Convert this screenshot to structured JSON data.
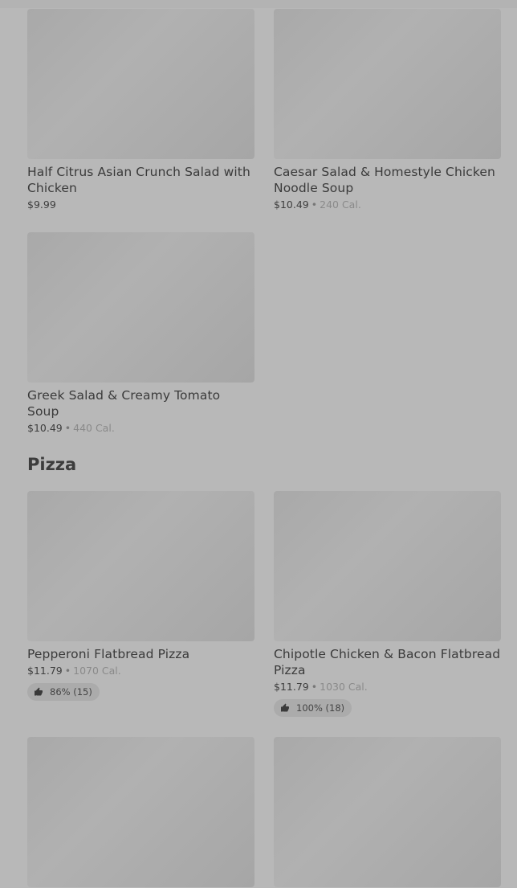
{
  "salads_and_soups": {
    "items": [
      {
        "name": "Half Citrus Asian Crunch Salad with Chicken",
        "price": "$9.99",
        "calories": ""
      },
      {
        "name": "Caesar Salad & Homestyle Chicken Noodle Soup",
        "price": "$10.49",
        "calories": "240 Cal."
      },
      {
        "name": "Greek Salad & Creamy Tomato Soup",
        "price": "$10.49",
        "calories": "440 Cal."
      }
    ]
  },
  "pizza": {
    "title": "Pizza",
    "items": [
      {
        "name": "Pepperoni Flatbread Pizza",
        "price": "$11.79",
        "calories": "1070 Cal.",
        "rating": "86% (15)"
      },
      {
        "name": "Chipotle Chicken & Bacon Flatbread Pizza",
        "price": "$11.79",
        "calories": "1030 Cal.",
        "rating": "100% (18)"
      }
    ]
  },
  "colors": {
    "overlay_background": "#b8b8b8",
    "thumbnail": "#adadad",
    "rating_pill": "#ababab"
  },
  "icons": {
    "rating": "thumbs-up-icon"
  }
}
